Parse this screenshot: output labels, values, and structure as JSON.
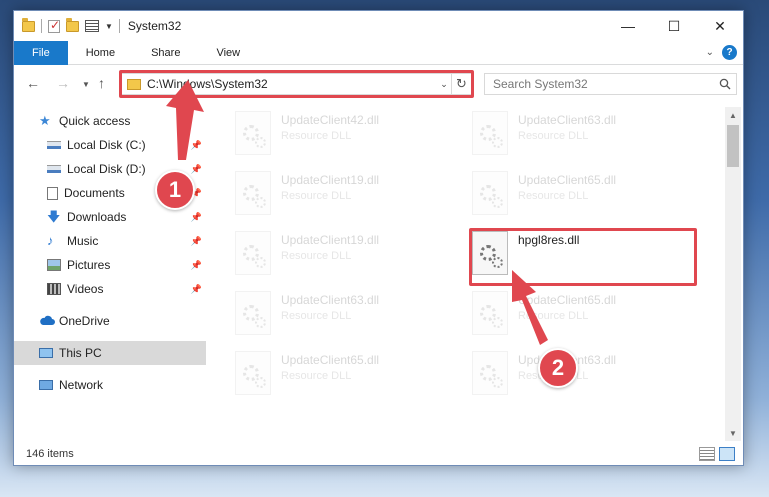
{
  "window": {
    "title": "System32"
  },
  "ribbon": {
    "tabs": [
      "File",
      "Home",
      "Share",
      "View"
    ]
  },
  "address": {
    "path": "C:\\Windows\\System32"
  },
  "search": {
    "placeholder": "Search System32"
  },
  "sidebar": {
    "quick_access": "Quick access",
    "items": [
      {
        "label": "Local Disk (C:)",
        "icon": "drive-icon",
        "pinned": true
      },
      {
        "label": "Local Disk (D:)",
        "icon": "drive-icon",
        "pinned": true
      },
      {
        "label": "Documents",
        "icon": "documents-icon",
        "pinned": true
      },
      {
        "label": "Downloads",
        "icon": "downloads-icon",
        "pinned": true
      },
      {
        "label": "Music",
        "icon": "music-icon",
        "pinned": true
      },
      {
        "label": "Pictures",
        "icon": "pictures-icon",
        "pinned": true
      },
      {
        "label": "Videos",
        "icon": "videos-icon",
        "pinned": true
      }
    ],
    "onedrive": "OneDrive",
    "this_pc": "This PC",
    "network": "Network"
  },
  "files": [
    {
      "name": "UpdateClient42.dll",
      "type": "Resource DLL",
      "faded": true
    },
    {
      "name": "UpdateClient63.dll",
      "type": "Resource DLL",
      "faded": true
    },
    {
      "name": "UpdateClient19.dll",
      "type": "Resource DLL",
      "faded": true
    },
    {
      "name": "UpdateClient65.dll",
      "type": "Resource DLL",
      "faded": true
    },
    {
      "name": "UpdateClient19.dll",
      "type": "Resource DLL",
      "faded": true
    },
    {
      "name": "hpgl8res.dll",
      "type": "",
      "faded": false
    },
    {
      "name": "UpdateClient63.dll",
      "type": "Resource DLL",
      "faded": true
    },
    {
      "name": "UpdateClient65.dll",
      "type": "Resource DLL",
      "faded": true
    },
    {
      "name": "UpdateClient65.dll",
      "type": "Resource DLL",
      "faded": true
    },
    {
      "name": "UpdateClient63.dll",
      "type": "Resource DLL",
      "faded": true
    }
  ],
  "status": {
    "item_count": "146 items"
  },
  "annotations": {
    "step1": "1",
    "step2": "2"
  },
  "colors": {
    "accent": "#1979ca",
    "highlight": "#e0474f"
  }
}
